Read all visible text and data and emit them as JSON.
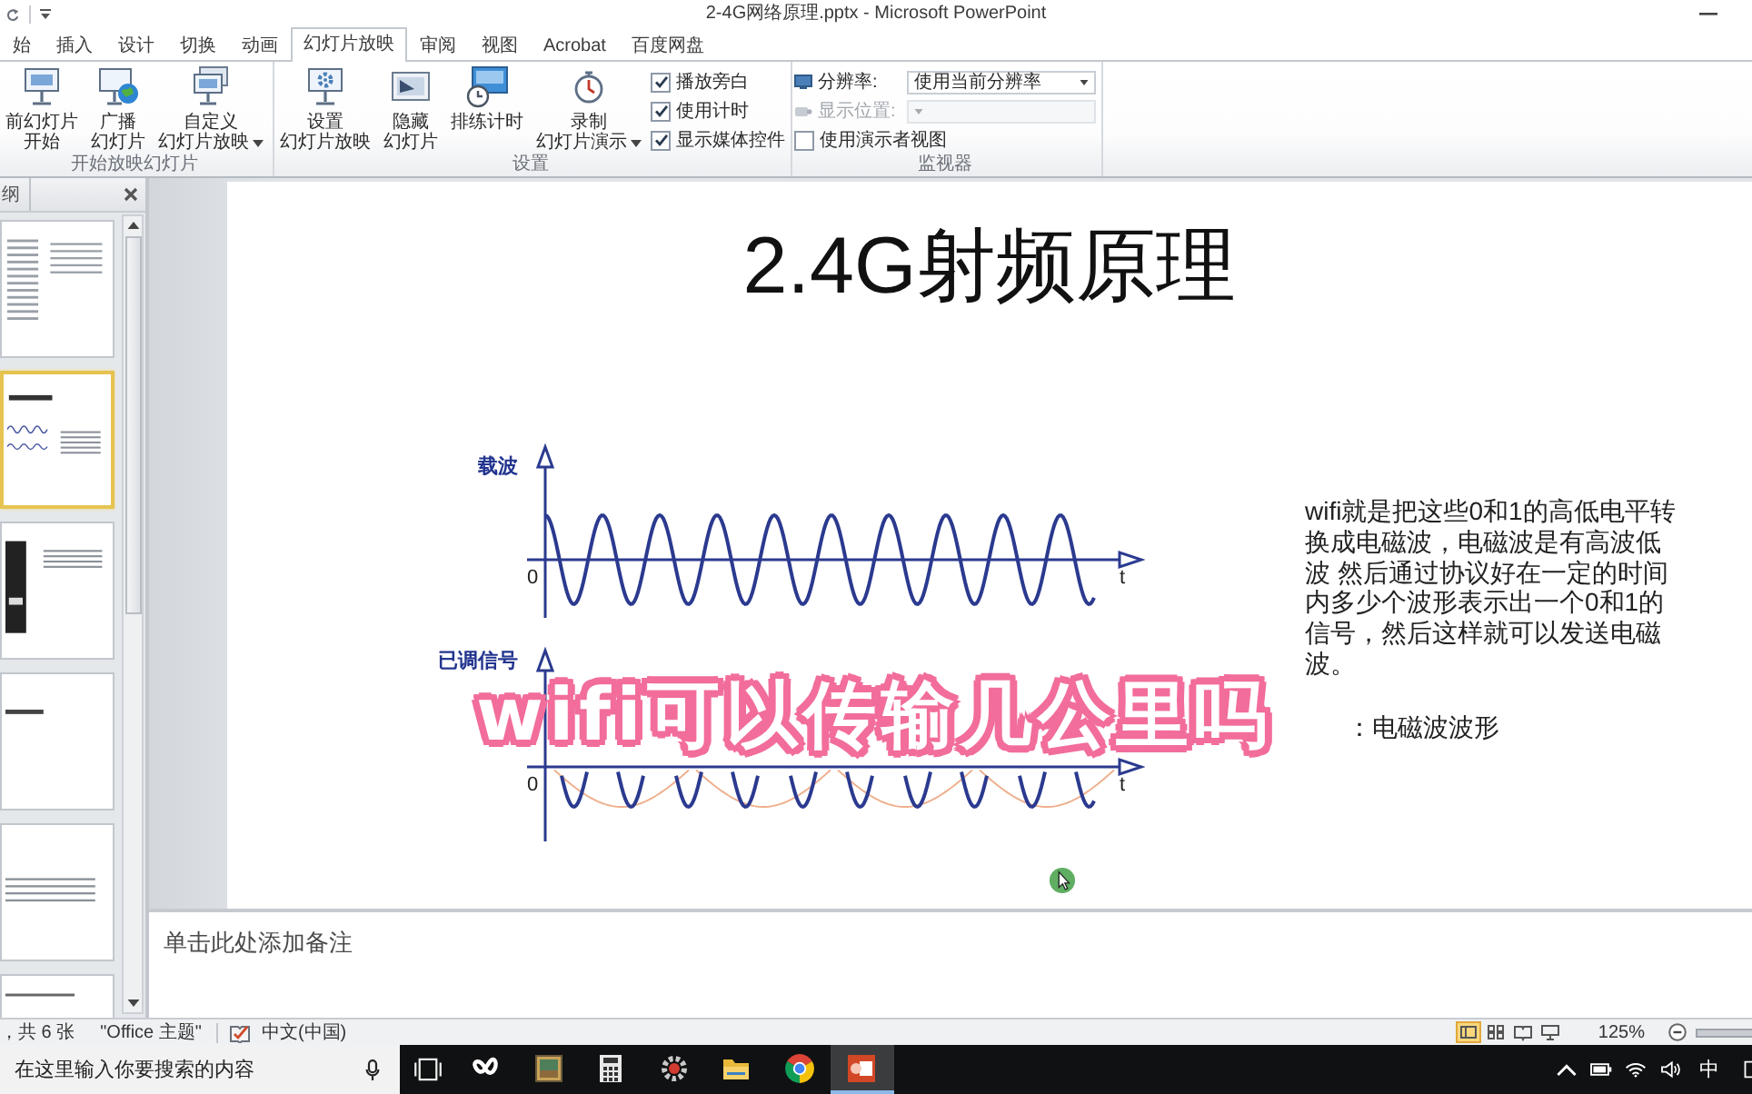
{
  "window": {
    "title": "2-4G网络原理.pptx - Microsoft PowerPoint"
  },
  "ribbon_tabs": [
    {
      "label": "始",
      "selected": false
    },
    {
      "label": "插入",
      "selected": false
    },
    {
      "label": "设计",
      "selected": false
    },
    {
      "label": "切换",
      "selected": false
    },
    {
      "label": "动画",
      "selected": false
    },
    {
      "label": "幻灯片放映",
      "selected": true
    },
    {
      "label": "审阅",
      "selected": false
    },
    {
      "label": "视图",
      "selected": false
    },
    {
      "label": "Acrobat",
      "selected": false
    },
    {
      "label": "百度网盘",
      "selected": false
    }
  ],
  "ribbon_groups": [
    {
      "label": "开始放映幻灯片",
      "items": [
        {
          "kind": "button",
          "lines": [
            "前幻灯片",
            "开始"
          ],
          "has_menu": false
        },
        {
          "kind": "button",
          "lines": [
            "广播",
            "幻灯片"
          ],
          "has_menu": false
        },
        {
          "kind": "button",
          "lines": [
            "自定义",
            "幻灯片放映"
          ],
          "has_menu": true
        }
      ]
    },
    {
      "label": "设置",
      "items": [
        {
          "kind": "button",
          "lines": [
            "设置",
            "幻灯片放映"
          ],
          "has_menu": false
        },
        {
          "kind": "button",
          "lines": [
            "隐藏",
            "幻灯片"
          ],
          "has_menu": false
        },
        {
          "kind": "button",
          "lines": [
            "排练计时"
          ],
          "has_menu": false
        },
        {
          "kind": "button",
          "lines": [
            "录制",
            "幻灯片演示"
          ],
          "has_menu": true
        },
        {
          "kind": "checkbox",
          "label": "播放旁白",
          "checked": true
        },
        {
          "kind": "checkbox",
          "label": "使用计时",
          "checked": true
        },
        {
          "kind": "checkbox",
          "label": "显示媒体控件",
          "checked": true
        }
      ]
    },
    {
      "label": "监视器",
      "items": [
        {
          "kind": "select",
          "label": "分辨率:",
          "value": "使用当前分辨率",
          "disabled": false
        },
        {
          "kind": "select",
          "label": "显示位置:",
          "disabled": true
        },
        {
          "kind": "checkbox",
          "label": "使用演示者视图",
          "checked": false
        }
      ]
    }
  ],
  "outline_pane": {
    "tab": "纲",
    "slides": [
      {
        "selected": false
      },
      {
        "selected": true
      },
      {
        "selected": false
      },
      {
        "selected": false
      },
      {
        "selected": false
      },
      {
        "selected": false
      }
    ]
  },
  "slide": {
    "title": "2.4G射频原理",
    "figure": {
      "panels": [
        {
          "kind": "carrier",
          "label": "载波",
          "origin": "0",
          "axis": "t"
        },
        {
          "kind": "modulated",
          "label": "已调信号",
          "origin": "0",
          "axis": "t"
        }
      ]
    },
    "paragraph": "wifi就是把这些0和1的高低电平转换成电磁波，电磁波是有高波低波 然后通过协议好在一定的时间内多少个波形表示出一个0和1的信号，然后这样就可以发送电磁波。",
    "figure_caption": "：电磁波波形",
    "overlay_caption": "wifi可以传输几公里吗"
  },
  "notes": {
    "placeholder": "单击此处添加备注"
  },
  "status_bar": {
    "slide_position": "，共 6 张",
    "theme": "\"Office 主题\"",
    "language": "中文(中国)",
    "views": [
      {
        "selected": true
      },
      {
        "selected": false
      },
      {
        "selected": false
      },
      {
        "selected": false
      }
    ],
    "zoom": "125%"
  },
  "taskbar": {
    "search": {
      "placeholder": "在这里输入你要搜索的内容"
    },
    "apps": [
      {
        "selected": false
      },
      {
        "selected": false
      },
      {
        "selected": false
      },
      {
        "selected": false
      },
      {
        "selected": false
      },
      {
        "selected": false
      },
      {
        "selected": true
      }
    ],
    "input_method": "中"
  }
}
